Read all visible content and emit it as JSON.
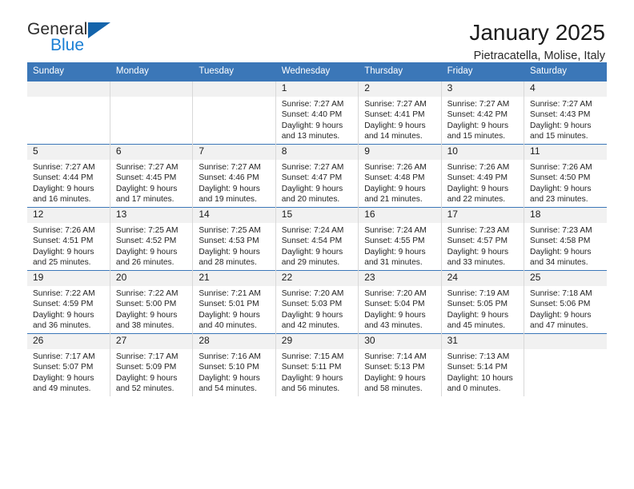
{
  "brand": {
    "name_part1": "General",
    "name_part2": "Blue",
    "accent_color": "#1a7fd4",
    "triangle_color": "#1464ab"
  },
  "header": {
    "title": "January 2025",
    "subtitle": "Pietracatella, Molise, Italy"
  },
  "theme": {
    "header_blue": "#3b77b8",
    "daynum_bg": "#f1f1f1"
  },
  "weekdays": [
    "Sunday",
    "Monday",
    "Tuesday",
    "Wednesday",
    "Thursday",
    "Friday",
    "Saturday"
  ],
  "weeks": [
    [
      {
        "day": "",
        "sunrise": "",
        "sunset": "",
        "daylight_line1": "",
        "daylight_line2": ""
      },
      {
        "day": "",
        "sunrise": "",
        "sunset": "",
        "daylight_line1": "",
        "daylight_line2": ""
      },
      {
        "day": "",
        "sunrise": "",
        "sunset": "",
        "daylight_line1": "",
        "daylight_line2": ""
      },
      {
        "day": "1",
        "sunrise": "Sunrise: 7:27 AM",
        "sunset": "Sunset: 4:40 PM",
        "daylight_line1": "Daylight: 9 hours",
        "daylight_line2": "and 13 minutes."
      },
      {
        "day": "2",
        "sunrise": "Sunrise: 7:27 AM",
        "sunset": "Sunset: 4:41 PM",
        "daylight_line1": "Daylight: 9 hours",
        "daylight_line2": "and 14 minutes."
      },
      {
        "day": "3",
        "sunrise": "Sunrise: 7:27 AM",
        "sunset": "Sunset: 4:42 PM",
        "daylight_line1": "Daylight: 9 hours",
        "daylight_line2": "and 15 minutes."
      },
      {
        "day": "4",
        "sunrise": "Sunrise: 7:27 AM",
        "sunset": "Sunset: 4:43 PM",
        "daylight_line1": "Daylight: 9 hours",
        "daylight_line2": "and 15 minutes."
      }
    ],
    [
      {
        "day": "5",
        "sunrise": "Sunrise: 7:27 AM",
        "sunset": "Sunset: 4:44 PM",
        "daylight_line1": "Daylight: 9 hours",
        "daylight_line2": "and 16 minutes."
      },
      {
        "day": "6",
        "sunrise": "Sunrise: 7:27 AM",
        "sunset": "Sunset: 4:45 PM",
        "daylight_line1": "Daylight: 9 hours",
        "daylight_line2": "and 17 minutes."
      },
      {
        "day": "7",
        "sunrise": "Sunrise: 7:27 AM",
        "sunset": "Sunset: 4:46 PM",
        "daylight_line1": "Daylight: 9 hours",
        "daylight_line2": "and 19 minutes."
      },
      {
        "day": "8",
        "sunrise": "Sunrise: 7:27 AM",
        "sunset": "Sunset: 4:47 PM",
        "daylight_line1": "Daylight: 9 hours",
        "daylight_line2": "and 20 minutes."
      },
      {
        "day": "9",
        "sunrise": "Sunrise: 7:26 AM",
        "sunset": "Sunset: 4:48 PM",
        "daylight_line1": "Daylight: 9 hours",
        "daylight_line2": "and 21 minutes."
      },
      {
        "day": "10",
        "sunrise": "Sunrise: 7:26 AM",
        "sunset": "Sunset: 4:49 PM",
        "daylight_line1": "Daylight: 9 hours",
        "daylight_line2": "and 22 minutes."
      },
      {
        "day": "11",
        "sunrise": "Sunrise: 7:26 AM",
        "sunset": "Sunset: 4:50 PM",
        "daylight_line1": "Daylight: 9 hours",
        "daylight_line2": "and 23 minutes."
      }
    ],
    [
      {
        "day": "12",
        "sunrise": "Sunrise: 7:26 AM",
        "sunset": "Sunset: 4:51 PM",
        "daylight_line1": "Daylight: 9 hours",
        "daylight_line2": "and 25 minutes."
      },
      {
        "day": "13",
        "sunrise": "Sunrise: 7:25 AM",
        "sunset": "Sunset: 4:52 PM",
        "daylight_line1": "Daylight: 9 hours",
        "daylight_line2": "and 26 minutes."
      },
      {
        "day": "14",
        "sunrise": "Sunrise: 7:25 AM",
        "sunset": "Sunset: 4:53 PM",
        "daylight_line1": "Daylight: 9 hours",
        "daylight_line2": "and 28 minutes."
      },
      {
        "day": "15",
        "sunrise": "Sunrise: 7:24 AM",
        "sunset": "Sunset: 4:54 PM",
        "daylight_line1": "Daylight: 9 hours",
        "daylight_line2": "and 29 minutes."
      },
      {
        "day": "16",
        "sunrise": "Sunrise: 7:24 AM",
        "sunset": "Sunset: 4:55 PM",
        "daylight_line1": "Daylight: 9 hours",
        "daylight_line2": "and 31 minutes."
      },
      {
        "day": "17",
        "sunrise": "Sunrise: 7:23 AM",
        "sunset": "Sunset: 4:57 PM",
        "daylight_line1": "Daylight: 9 hours",
        "daylight_line2": "and 33 minutes."
      },
      {
        "day": "18",
        "sunrise": "Sunrise: 7:23 AM",
        "sunset": "Sunset: 4:58 PM",
        "daylight_line1": "Daylight: 9 hours",
        "daylight_line2": "and 34 minutes."
      }
    ],
    [
      {
        "day": "19",
        "sunrise": "Sunrise: 7:22 AM",
        "sunset": "Sunset: 4:59 PM",
        "daylight_line1": "Daylight: 9 hours",
        "daylight_line2": "and 36 minutes."
      },
      {
        "day": "20",
        "sunrise": "Sunrise: 7:22 AM",
        "sunset": "Sunset: 5:00 PM",
        "daylight_line1": "Daylight: 9 hours",
        "daylight_line2": "and 38 minutes."
      },
      {
        "day": "21",
        "sunrise": "Sunrise: 7:21 AM",
        "sunset": "Sunset: 5:01 PM",
        "daylight_line1": "Daylight: 9 hours",
        "daylight_line2": "and 40 minutes."
      },
      {
        "day": "22",
        "sunrise": "Sunrise: 7:20 AM",
        "sunset": "Sunset: 5:03 PM",
        "daylight_line1": "Daylight: 9 hours",
        "daylight_line2": "and 42 minutes."
      },
      {
        "day": "23",
        "sunrise": "Sunrise: 7:20 AM",
        "sunset": "Sunset: 5:04 PM",
        "daylight_line1": "Daylight: 9 hours",
        "daylight_line2": "and 43 minutes."
      },
      {
        "day": "24",
        "sunrise": "Sunrise: 7:19 AM",
        "sunset": "Sunset: 5:05 PM",
        "daylight_line1": "Daylight: 9 hours",
        "daylight_line2": "and 45 minutes."
      },
      {
        "day": "25",
        "sunrise": "Sunrise: 7:18 AM",
        "sunset": "Sunset: 5:06 PM",
        "daylight_line1": "Daylight: 9 hours",
        "daylight_line2": "and 47 minutes."
      }
    ],
    [
      {
        "day": "26",
        "sunrise": "Sunrise: 7:17 AM",
        "sunset": "Sunset: 5:07 PM",
        "daylight_line1": "Daylight: 9 hours",
        "daylight_line2": "and 49 minutes."
      },
      {
        "day": "27",
        "sunrise": "Sunrise: 7:17 AM",
        "sunset": "Sunset: 5:09 PM",
        "daylight_line1": "Daylight: 9 hours",
        "daylight_line2": "and 52 minutes."
      },
      {
        "day": "28",
        "sunrise": "Sunrise: 7:16 AM",
        "sunset": "Sunset: 5:10 PM",
        "daylight_line1": "Daylight: 9 hours",
        "daylight_line2": "and 54 minutes."
      },
      {
        "day": "29",
        "sunrise": "Sunrise: 7:15 AM",
        "sunset": "Sunset: 5:11 PM",
        "daylight_line1": "Daylight: 9 hours",
        "daylight_line2": "and 56 minutes."
      },
      {
        "day": "30",
        "sunrise": "Sunrise: 7:14 AM",
        "sunset": "Sunset: 5:13 PM",
        "daylight_line1": "Daylight: 9 hours",
        "daylight_line2": "and 58 minutes."
      },
      {
        "day": "31",
        "sunrise": "Sunrise: 7:13 AM",
        "sunset": "Sunset: 5:14 PM",
        "daylight_line1": "Daylight: 10 hours",
        "daylight_line2": "and 0 minutes."
      },
      {
        "day": "",
        "sunrise": "",
        "sunset": "",
        "daylight_line1": "",
        "daylight_line2": ""
      }
    ]
  ]
}
